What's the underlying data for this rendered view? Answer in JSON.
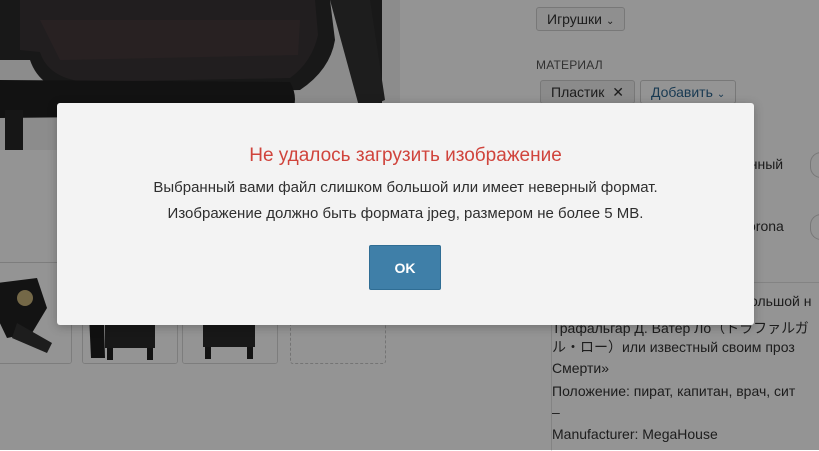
{
  "category": {
    "selected": "Игрушки"
  },
  "material": {
    "section_label": "МАТЕРИАЛ",
    "tag": "Пластик",
    "add_label": "Добавить"
  },
  "options": {
    "option1_partial": "енный",
    "option2_partial": "orona"
  },
  "description": {
    "line1_partial": "большой н",
    "line2": "Трафальгар Д. Ватер Ло（トラファルガ",
    "line3": "ル・ロー）или известный своим проз",
    "line4": "Смерти»",
    "line5": "Положение: пират, капитан, врач, сит",
    "line6": "–",
    "line7": "Manufacturer: MegaHouse"
  },
  "modal": {
    "title": "Не удалось загрузить изображение",
    "line1": "Выбранный вами файл слишком большой или имеет неверный формат.",
    "line2": "Изображение должно быть формата jpeg, размером не более 5 MB.",
    "ok_label": "OK"
  },
  "colors": {
    "error_title": "#d0443c",
    "ok_button": "#3f7fa8",
    "overlay": "rgba(0,0,0,0.42)"
  }
}
